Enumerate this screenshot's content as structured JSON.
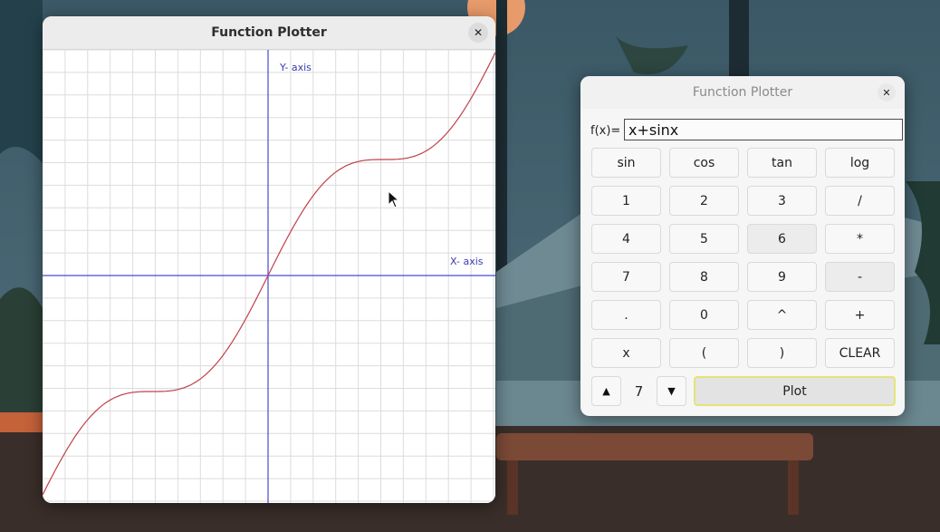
{
  "plot_window": {
    "title": "Function Plotter",
    "close_label": "✕",
    "y_axis_label": "Y- axis",
    "x_axis_label": "X- axis",
    "function": "x+sinx",
    "colors": {
      "grid": "#dcdcdc",
      "axes": "#4a4ad0",
      "curve": "#c0404a",
      "axis_label": "#3a3ab0"
    }
  },
  "calculator": {
    "title": "Function Plotter",
    "close_label": "✕",
    "fx_label": "f(x)=",
    "fx_value": "x+sinx",
    "keys": [
      "sin",
      "cos",
      "tan",
      "log",
      "1",
      "2",
      "3",
      "/",
      "4",
      "5",
      "6",
      "*",
      "7",
      "8",
      "9",
      "-",
      ".",
      "0",
      "^",
      "+",
      "x",
      "(",
      ")",
      "CLEAR"
    ],
    "up_label": "▲",
    "down_label": "▼",
    "step_value": "7",
    "plot_label": "Plot"
  },
  "icons": {
    "plot_close": "close-icon",
    "calc_close": "close-icon",
    "cursor": "mouse-pointer-icon"
  }
}
